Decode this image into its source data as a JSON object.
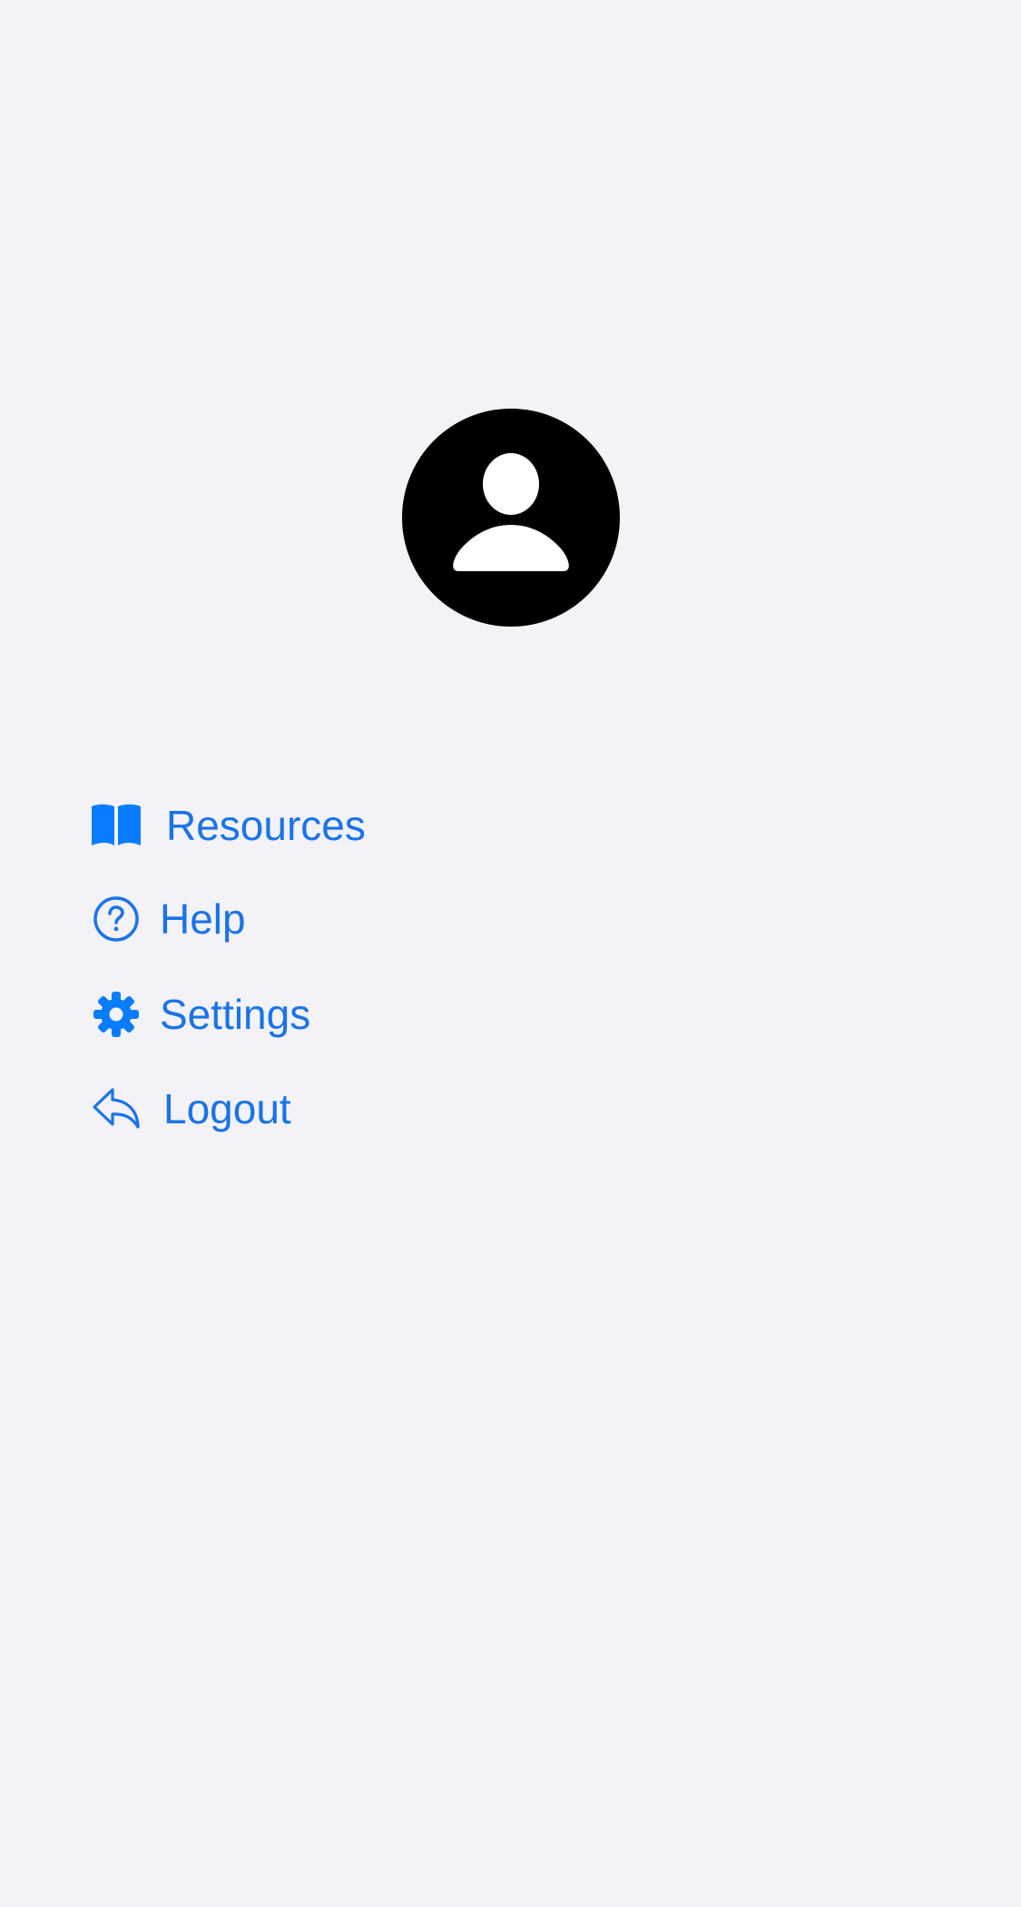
{
  "profile": {
    "avatar_icon": "person-circle-icon"
  },
  "menu": {
    "items": [
      {
        "label": "Resources",
        "icon": "book-icon"
      },
      {
        "label": "Help",
        "icon": "question-circle-icon"
      },
      {
        "label": "Settings",
        "icon": "gear-icon"
      },
      {
        "label": "Logout",
        "icon": "reply-arrow-icon"
      }
    ]
  },
  "colors": {
    "background": "#f2f2f7",
    "accent": "#1a73e8",
    "avatar": "#000000"
  }
}
